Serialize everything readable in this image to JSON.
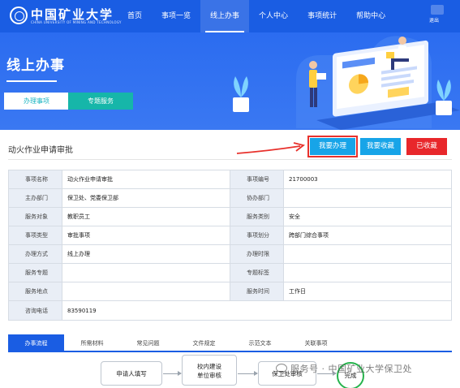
{
  "header": {
    "logo_cn": "中国矿业大学",
    "logo_en": "CHINA UNIVERSITY OF MINING AND TECHNOLOGY",
    "nav": [
      "首页",
      "事项一览",
      "线上办事",
      "个人中心",
      "事项统计",
      "帮助中心"
    ],
    "active_nav_index": 2,
    "logout": "退出"
  },
  "hero": {
    "title": "线上办事",
    "tabs": [
      "办理事项",
      "专题服务"
    ]
  },
  "item": {
    "title": "动火作业申请审批",
    "actions": {
      "handle": "我要办理",
      "favorite": "我要收藏",
      "favorited": "已收藏"
    }
  },
  "info": {
    "rows": [
      [
        "事项名称",
        "动火作业申请审批",
        "事项编号",
        "21700003"
      ],
      [
        "主办部门",
        "保卫处、党委保卫部",
        "协办部门",
        ""
      ],
      [
        "服务对象",
        "教职员工",
        "服务类别",
        "安全"
      ],
      [
        "事项类型",
        "审批事项",
        "事项划分",
        "跨部门综合事项"
      ],
      [
        "办理方式",
        "线上办理",
        "办理时限",
        ""
      ],
      [
        "服务专题",
        "",
        "专题标签",
        ""
      ],
      [
        "服务地点",
        "",
        "服务时间",
        "工作日"
      ],
      [
        "咨询电话",
        "83590119"
      ]
    ]
  },
  "detail_tabs": [
    "办事流程",
    "所需材料",
    "常见问题",
    "文件规定",
    "示范文本",
    "关联事项"
  ],
  "flow": {
    "step1": "申请人填写",
    "step2_line1": "校内建设",
    "step2_line2": "单位审核",
    "step3": "保卫处审核",
    "end": "完成"
  },
  "watermark": "服务号 · 中国矿业大学保卫处",
  "colors": {
    "primary": "#1a5de3",
    "accent": "#16b6a9",
    "button": "#17a4e8",
    "danger": "#e8272b"
  }
}
